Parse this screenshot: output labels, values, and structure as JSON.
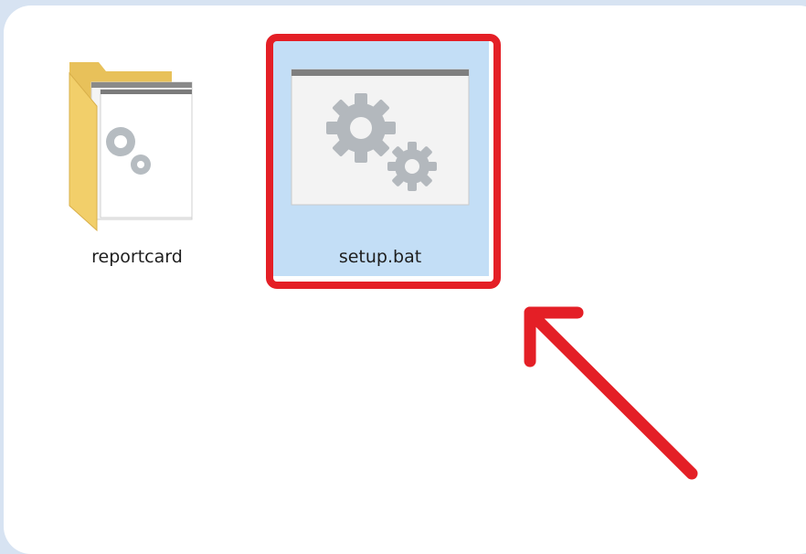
{
  "files": [
    {
      "name": "reportcard",
      "type": "folder",
      "icon": "folder-with-settings-icon"
    },
    {
      "name": "setup.bat",
      "type": "batch-file",
      "icon": "batch-file-gears-icon",
      "selected": true
    }
  ],
  "annotation": {
    "highlight_color": "#e41f26",
    "selection_color": "#c3def6"
  }
}
